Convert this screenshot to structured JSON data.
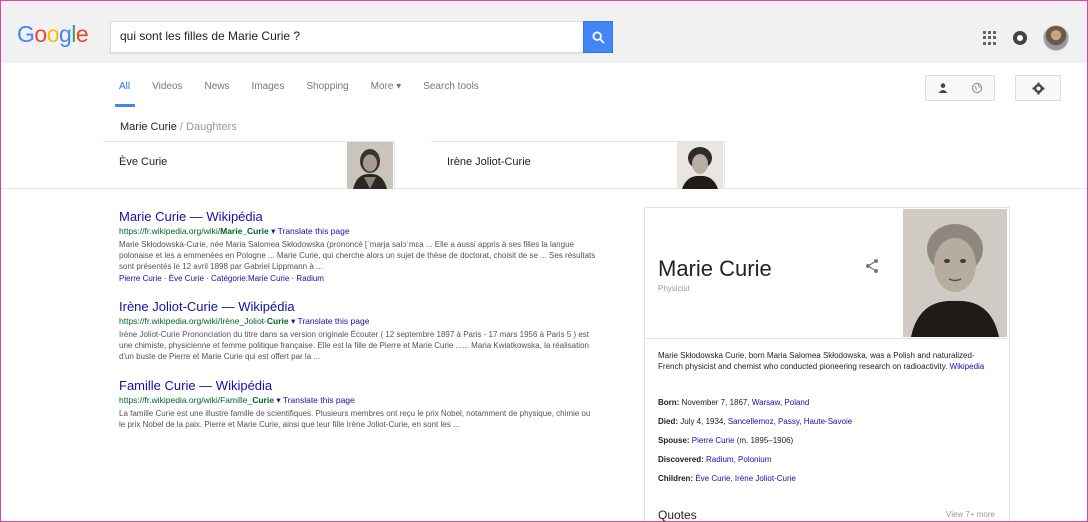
{
  "header": {
    "logo": [
      {
        "ch": "G",
        "color": "#4285f4"
      },
      {
        "ch": "o",
        "color": "#ea4335"
      },
      {
        "ch": "o",
        "color": "#fbbc05"
      },
      {
        "ch": "g",
        "color": "#4285f4"
      },
      {
        "ch": "l",
        "color": "#34a853"
      },
      {
        "ch": "e",
        "color": "#ea4335"
      }
    ],
    "query": "qui sont les filles de Marie Curie ?"
  },
  "nav": {
    "tabs": [
      "All",
      "Videos",
      "News",
      "Images",
      "Shopping",
      "More ▾",
      "Search tools"
    ]
  },
  "carousel": {
    "crumb_main": "Marie Curie",
    "crumb_sep": " / ",
    "crumb_sub": "Daughters",
    "items": [
      {
        "name": "Ève Curie"
      },
      {
        "name": "Irène Joliot-Curie"
      }
    ]
  },
  "results": [
    {
      "title": "Marie Curie — Wikipédia",
      "url_prefix": "https://fr.wikipedia.org/wiki/",
      "url_bold": "Marie_Curie",
      "translate": " ▾ Translate this page",
      "snippet": "Marie Skłodowska-Curie, née Maria Salomea Skłodowska (prononcé [ˈmarja salɔˈmɛa ... Elle a aussi appris à ses filles la langue polonaise et les a emmenées en Pologne ... Marie Curie, qui cherche alors un sujet de thèse de doctorat, choisit de se ... Ses résultats sont présentés le 12 avril 1898 par Gabriel Lippmann à ...",
      "links": [
        "Pierre Curie",
        "Ève Curie",
        "Catégorie:Marie Curie",
        "Radium"
      ]
    },
    {
      "title": "Irène Joliot-Curie — Wikipédia",
      "url_prefix": "https://fr.wikipedia.org/wiki/Irène_Joliot-",
      "url_bold": "Curie",
      "translate": " ▾ Translate this page",
      "snippet": "Irène Joliot-Curie Prononciation du titre dans sa version originale Écouter ( 12 septembre 1897 à Paris - 17 mars 1956 à Paris 5 ) est une chimiste, physicienne et femme politique française. Elle est la fille de Pierre et Marie Curie ...... Maria Kwiatkowska, la réalisation d'un buste de Pierre et Marie Curie qui est offert par la ...",
      "links": []
    },
    {
      "title": "Famille Curie — Wikipédia",
      "url_prefix": "https://fr.wikipedia.org/wiki/Famille_",
      "url_bold": "Curie",
      "translate": " ▾ Translate this page",
      "snippet": "La famille Curie est une illustre famille de scientifiques. Plusieurs membres ont reçu le prix Nobel, notamment de physique, chimie ou le prix Nobel de la paix. Pierre et Marie Curie, ainsi que leur fille Irène Joliot-Curie, en sont les ...",
      "links": []
    }
  ],
  "knowledge_panel": {
    "title": "Marie Curie",
    "subtitle": "Physicist",
    "description": "Marie Skłodowska Curie, born Maria Salomea Skłodowska, was a Polish and naturalized-French physicist and chemist who conducted pioneering research on radioactivity.",
    "description_link": "Wikipedia",
    "facts": [
      {
        "label": "Born:",
        "text": " November 7, 1867, ",
        "links": "Warsaw, Poland"
      },
      {
        "label": "Died:",
        "text": " July 4, 1934, ",
        "links": "Sancellemoz, Passy, Haute-Savoie"
      },
      {
        "label": "Spouse:",
        "text": " ",
        "links": "Pierre Curie",
        "suffix": " (m. 1895–1906)"
      },
      {
        "label": "Discovered:",
        "text": " ",
        "links": "Radium, Polonium"
      },
      {
        "label": "Children:",
        "text": " ",
        "links": "Ève Curie, Irène Joliot-Curie"
      }
    ],
    "quotes_label": "Quotes",
    "more_label": "View 7+ more"
  }
}
